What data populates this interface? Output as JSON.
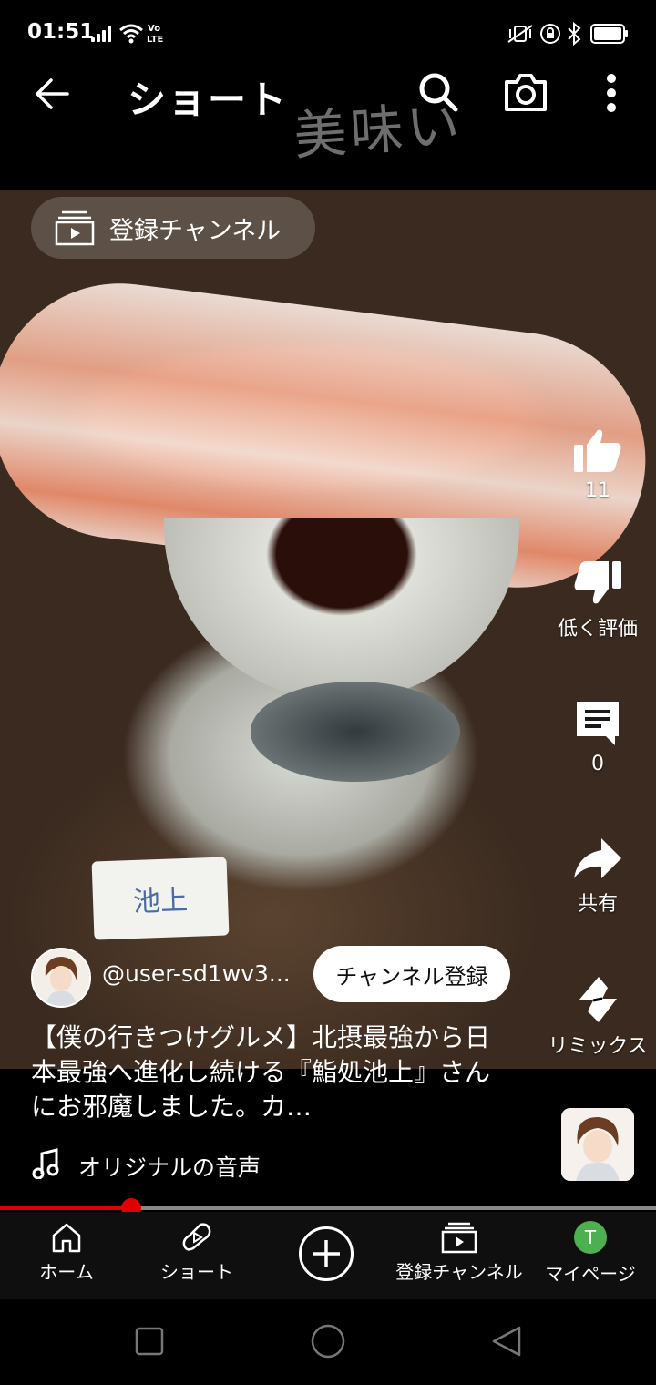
{
  "status_bar": {
    "time": "01:51"
  },
  "header": {
    "title": "ショート",
    "overlay_text": "美味い"
  },
  "video": {
    "subscriptions_chip_label": "登録チャンネル",
    "card_text": "池上"
  },
  "actions": {
    "like_count": "11",
    "dislike_label": "低く評価",
    "comments_count": "0",
    "share_label": "共有",
    "remix_label": "リミックス"
  },
  "channel": {
    "handle": "@user-sd1wv3...",
    "subscribe_label": "チャンネル登録"
  },
  "video_title": "【僕の行きつけグルメ】北摂最強から日本最強へ進化し続ける『鮨処池上』さんにお邪魔しました。カ…",
  "audio": {
    "label": "オリジナルの音声"
  },
  "progress": {
    "fraction": 0.2
  },
  "bottom_nav": {
    "home": "ホーム",
    "shorts": "ショート",
    "subscriptions": "登録チャンネル",
    "mypage": "マイページ",
    "avatar_letter": "T"
  },
  "colors": {
    "progress": "#e00000",
    "avatar": "#4caf50"
  }
}
